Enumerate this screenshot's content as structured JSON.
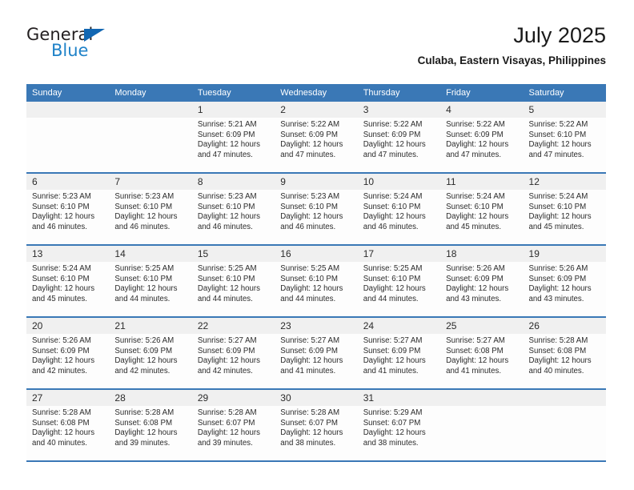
{
  "brand": {
    "name_part1": "General",
    "name_part2": "Blue",
    "triangle_color": "#1267b2",
    "blue_color": "#1f82c8"
  },
  "header": {
    "title": "July 2025",
    "subtitle": "Culaba, Eastern Visayas, Philippines"
  },
  "theme": {
    "header_blue": "#3a78b6",
    "daynum_bg": "#f0f0f0",
    "cell_bg": "#fdfdfd",
    "text": "#2b2b2b"
  },
  "weekdays": [
    "Sunday",
    "Monday",
    "Tuesday",
    "Wednesday",
    "Thursday",
    "Friday",
    "Saturday"
  ],
  "weeks": [
    {
      "days": [
        {
          "num": "",
          "sunrise": "",
          "sunset": "",
          "daylight_l1": "",
          "daylight_l2": "",
          "empty": true
        },
        {
          "num": "",
          "sunrise": "",
          "sunset": "",
          "daylight_l1": "",
          "daylight_l2": "",
          "empty": true
        },
        {
          "num": "1",
          "sunrise": "Sunrise: 5:21 AM",
          "sunset": "Sunset: 6:09 PM",
          "daylight_l1": "Daylight: 12 hours",
          "daylight_l2": "and 47 minutes."
        },
        {
          "num": "2",
          "sunrise": "Sunrise: 5:22 AM",
          "sunset": "Sunset: 6:09 PM",
          "daylight_l1": "Daylight: 12 hours",
          "daylight_l2": "and 47 minutes."
        },
        {
          "num": "3",
          "sunrise": "Sunrise: 5:22 AM",
          "sunset": "Sunset: 6:09 PM",
          "daylight_l1": "Daylight: 12 hours",
          "daylight_l2": "and 47 minutes."
        },
        {
          "num": "4",
          "sunrise": "Sunrise: 5:22 AM",
          "sunset": "Sunset: 6:09 PM",
          "daylight_l1": "Daylight: 12 hours",
          "daylight_l2": "and 47 minutes."
        },
        {
          "num": "5",
          "sunrise": "Sunrise: 5:22 AM",
          "sunset": "Sunset: 6:10 PM",
          "daylight_l1": "Daylight: 12 hours",
          "daylight_l2": "and 47 minutes."
        }
      ]
    },
    {
      "days": [
        {
          "num": "6",
          "sunrise": "Sunrise: 5:23 AM",
          "sunset": "Sunset: 6:10 PM",
          "daylight_l1": "Daylight: 12 hours",
          "daylight_l2": "and 46 minutes."
        },
        {
          "num": "7",
          "sunrise": "Sunrise: 5:23 AM",
          "sunset": "Sunset: 6:10 PM",
          "daylight_l1": "Daylight: 12 hours",
          "daylight_l2": "and 46 minutes."
        },
        {
          "num": "8",
          "sunrise": "Sunrise: 5:23 AM",
          "sunset": "Sunset: 6:10 PM",
          "daylight_l1": "Daylight: 12 hours",
          "daylight_l2": "and 46 minutes."
        },
        {
          "num": "9",
          "sunrise": "Sunrise: 5:23 AM",
          "sunset": "Sunset: 6:10 PM",
          "daylight_l1": "Daylight: 12 hours",
          "daylight_l2": "and 46 minutes."
        },
        {
          "num": "10",
          "sunrise": "Sunrise: 5:24 AM",
          "sunset": "Sunset: 6:10 PM",
          "daylight_l1": "Daylight: 12 hours",
          "daylight_l2": "and 46 minutes."
        },
        {
          "num": "11",
          "sunrise": "Sunrise: 5:24 AM",
          "sunset": "Sunset: 6:10 PM",
          "daylight_l1": "Daylight: 12 hours",
          "daylight_l2": "and 45 minutes."
        },
        {
          "num": "12",
          "sunrise": "Sunrise: 5:24 AM",
          "sunset": "Sunset: 6:10 PM",
          "daylight_l1": "Daylight: 12 hours",
          "daylight_l2": "and 45 minutes."
        }
      ]
    },
    {
      "days": [
        {
          "num": "13",
          "sunrise": "Sunrise: 5:24 AM",
          "sunset": "Sunset: 6:10 PM",
          "daylight_l1": "Daylight: 12 hours",
          "daylight_l2": "and 45 minutes."
        },
        {
          "num": "14",
          "sunrise": "Sunrise: 5:25 AM",
          "sunset": "Sunset: 6:10 PM",
          "daylight_l1": "Daylight: 12 hours",
          "daylight_l2": "and 44 minutes."
        },
        {
          "num": "15",
          "sunrise": "Sunrise: 5:25 AM",
          "sunset": "Sunset: 6:10 PM",
          "daylight_l1": "Daylight: 12 hours",
          "daylight_l2": "and 44 minutes."
        },
        {
          "num": "16",
          "sunrise": "Sunrise: 5:25 AM",
          "sunset": "Sunset: 6:10 PM",
          "daylight_l1": "Daylight: 12 hours",
          "daylight_l2": "and 44 minutes."
        },
        {
          "num": "17",
          "sunrise": "Sunrise: 5:25 AM",
          "sunset": "Sunset: 6:10 PM",
          "daylight_l1": "Daylight: 12 hours",
          "daylight_l2": "and 44 minutes."
        },
        {
          "num": "18",
          "sunrise": "Sunrise: 5:26 AM",
          "sunset": "Sunset: 6:09 PM",
          "daylight_l1": "Daylight: 12 hours",
          "daylight_l2": "and 43 minutes."
        },
        {
          "num": "19",
          "sunrise": "Sunrise: 5:26 AM",
          "sunset": "Sunset: 6:09 PM",
          "daylight_l1": "Daylight: 12 hours",
          "daylight_l2": "and 43 minutes."
        }
      ]
    },
    {
      "days": [
        {
          "num": "20",
          "sunrise": "Sunrise: 5:26 AM",
          "sunset": "Sunset: 6:09 PM",
          "daylight_l1": "Daylight: 12 hours",
          "daylight_l2": "and 42 minutes."
        },
        {
          "num": "21",
          "sunrise": "Sunrise: 5:26 AM",
          "sunset": "Sunset: 6:09 PM",
          "daylight_l1": "Daylight: 12 hours",
          "daylight_l2": "and 42 minutes."
        },
        {
          "num": "22",
          "sunrise": "Sunrise: 5:27 AM",
          "sunset": "Sunset: 6:09 PM",
          "daylight_l1": "Daylight: 12 hours",
          "daylight_l2": "and 42 minutes."
        },
        {
          "num": "23",
          "sunrise": "Sunrise: 5:27 AM",
          "sunset": "Sunset: 6:09 PM",
          "daylight_l1": "Daylight: 12 hours",
          "daylight_l2": "and 41 minutes."
        },
        {
          "num": "24",
          "sunrise": "Sunrise: 5:27 AM",
          "sunset": "Sunset: 6:09 PM",
          "daylight_l1": "Daylight: 12 hours",
          "daylight_l2": "and 41 minutes."
        },
        {
          "num": "25",
          "sunrise": "Sunrise: 5:27 AM",
          "sunset": "Sunset: 6:08 PM",
          "daylight_l1": "Daylight: 12 hours",
          "daylight_l2": "and 41 minutes."
        },
        {
          "num": "26",
          "sunrise": "Sunrise: 5:28 AM",
          "sunset": "Sunset: 6:08 PM",
          "daylight_l1": "Daylight: 12 hours",
          "daylight_l2": "and 40 minutes."
        }
      ]
    },
    {
      "days": [
        {
          "num": "27",
          "sunrise": "Sunrise: 5:28 AM",
          "sunset": "Sunset: 6:08 PM",
          "daylight_l1": "Daylight: 12 hours",
          "daylight_l2": "and 40 minutes."
        },
        {
          "num": "28",
          "sunrise": "Sunrise: 5:28 AM",
          "sunset": "Sunset: 6:08 PM",
          "daylight_l1": "Daylight: 12 hours",
          "daylight_l2": "and 39 minutes."
        },
        {
          "num": "29",
          "sunrise": "Sunrise: 5:28 AM",
          "sunset": "Sunset: 6:07 PM",
          "daylight_l1": "Daylight: 12 hours",
          "daylight_l2": "and 39 minutes."
        },
        {
          "num": "30",
          "sunrise": "Sunrise: 5:28 AM",
          "sunset": "Sunset: 6:07 PM",
          "daylight_l1": "Daylight: 12 hours",
          "daylight_l2": "and 38 minutes."
        },
        {
          "num": "31",
          "sunrise": "Sunrise: 5:29 AM",
          "sunset": "Sunset: 6:07 PM",
          "daylight_l1": "Daylight: 12 hours",
          "daylight_l2": "and 38 minutes."
        },
        {
          "num": "",
          "sunrise": "",
          "sunset": "",
          "daylight_l1": "",
          "daylight_l2": "",
          "empty": true
        },
        {
          "num": "",
          "sunrise": "",
          "sunset": "",
          "daylight_l1": "",
          "daylight_l2": "",
          "empty": true
        }
      ]
    }
  ]
}
